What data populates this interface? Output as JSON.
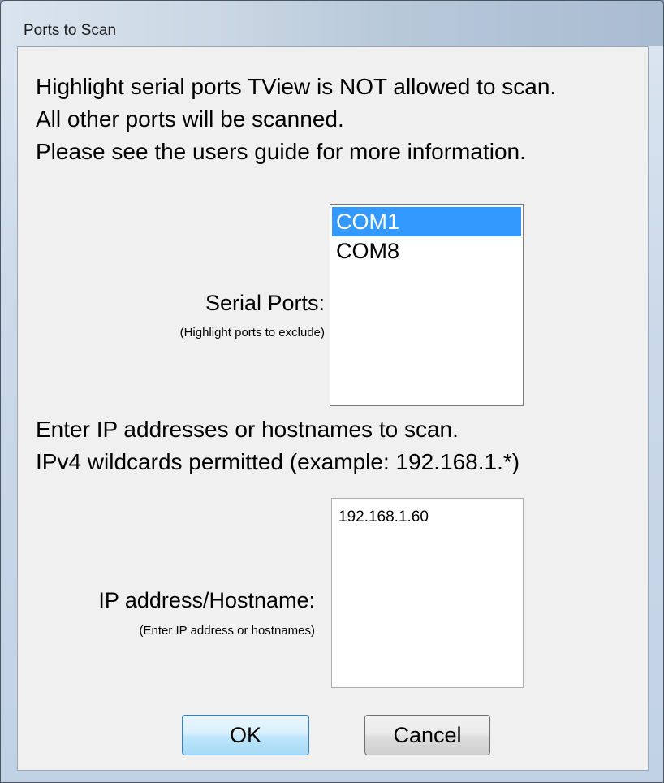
{
  "window": {
    "title": "Ports to Scan"
  },
  "instructions": {
    "line1": "Highlight serial ports TView is NOT allowed to scan.",
    "line2": "All other ports will be scanned.",
    "line3": "Please see the users guide for more information."
  },
  "serial_ports": {
    "label": "Serial Ports:",
    "hint": "(Highlight ports to exclude)",
    "items": [
      {
        "label": "COM1",
        "selected": true
      },
      {
        "label": "COM8",
        "selected": false
      }
    ]
  },
  "ip_section": {
    "line1": "Enter IP addresses or hostnames to scan.",
    "line2": "IPv4 wildcards permitted (example: 192.168.1.*)",
    "label": "IP address/Hostname:",
    "hint": "(Enter IP address or hostnames)",
    "value": "192.168.1.60"
  },
  "buttons": {
    "ok": "OK",
    "cancel": "Cancel"
  },
  "colors": {
    "selection": "#3399ff",
    "dialog_bg": "#f0f0f0"
  }
}
